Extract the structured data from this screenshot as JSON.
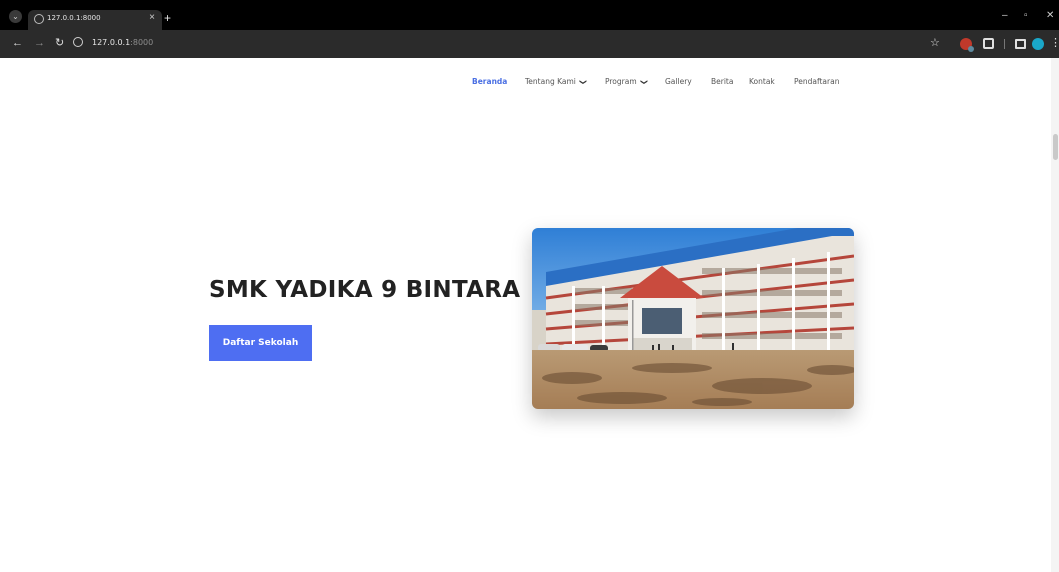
{
  "browser": {
    "tab_title": "127.0.0.1:8000",
    "tab_close": "×",
    "new_tab": "+",
    "url_host": "127.0.0.1",
    "url_port": ":8000",
    "icons": [
      "tab-search-icon",
      "site-info-icon",
      "back-icon",
      "forward-icon",
      "reload-icon",
      "bookmark-star-icon",
      "extension-icon",
      "puzzle-icon",
      "side-panel-icon",
      "profile-avatar",
      "menu-icon",
      "minimize-icon",
      "restore-icon",
      "close-icon"
    ]
  },
  "site": {
    "nav": [
      {
        "label": "Beranda",
        "active": true,
        "dropdown": false
      },
      {
        "label": "Tentang Kami",
        "active": false,
        "dropdown": true
      },
      {
        "label": "Program",
        "active": false,
        "dropdown": true
      },
      {
        "label": "Gallery",
        "active": false,
        "dropdown": false
      },
      {
        "label": "Berita",
        "active": false,
        "dropdown": false
      },
      {
        "label": "Kontak",
        "active": false,
        "dropdown": false
      },
      {
        "label": "Pendaftaran",
        "active": false,
        "dropdown": false
      }
    ],
    "hero": {
      "title": "SMK YADIKA 9 BINTARA",
      "cta_label": "Daftar Sekolah"
    },
    "colors": {
      "accent": "#4e6ef2",
      "active_nav": "#4a6fe3"
    }
  }
}
